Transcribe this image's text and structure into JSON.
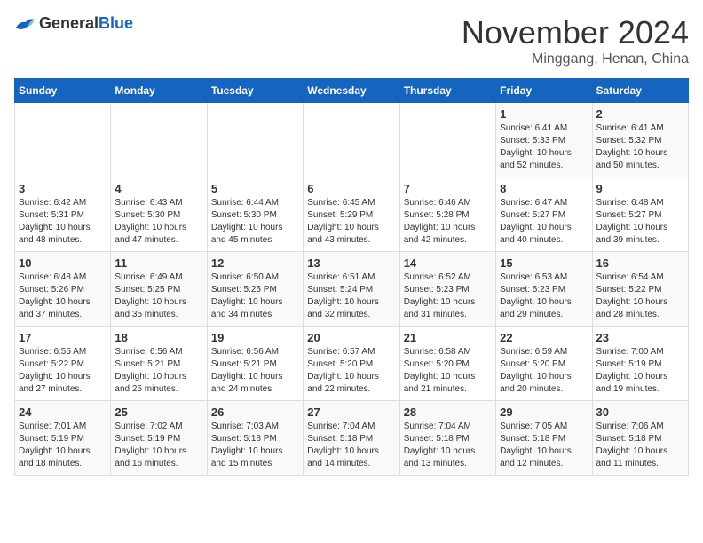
{
  "header": {
    "logo_general": "General",
    "logo_blue": "Blue",
    "month_title": "November 2024",
    "location": "Minggang, Henan, China"
  },
  "weekdays": [
    "Sunday",
    "Monday",
    "Tuesday",
    "Wednesday",
    "Thursday",
    "Friday",
    "Saturday"
  ],
  "weeks": [
    [
      {
        "day": "",
        "info": ""
      },
      {
        "day": "",
        "info": ""
      },
      {
        "day": "",
        "info": ""
      },
      {
        "day": "",
        "info": ""
      },
      {
        "day": "",
        "info": ""
      },
      {
        "day": "1",
        "info": "Sunrise: 6:41 AM\nSunset: 5:33 PM\nDaylight: 10 hours\nand 52 minutes."
      },
      {
        "day": "2",
        "info": "Sunrise: 6:41 AM\nSunset: 5:32 PM\nDaylight: 10 hours\nand 50 minutes."
      }
    ],
    [
      {
        "day": "3",
        "info": "Sunrise: 6:42 AM\nSunset: 5:31 PM\nDaylight: 10 hours\nand 48 minutes."
      },
      {
        "day": "4",
        "info": "Sunrise: 6:43 AM\nSunset: 5:30 PM\nDaylight: 10 hours\nand 47 minutes."
      },
      {
        "day": "5",
        "info": "Sunrise: 6:44 AM\nSunset: 5:30 PM\nDaylight: 10 hours\nand 45 minutes."
      },
      {
        "day": "6",
        "info": "Sunrise: 6:45 AM\nSunset: 5:29 PM\nDaylight: 10 hours\nand 43 minutes."
      },
      {
        "day": "7",
        "info": "Sunrise: 6:46 AM\nSunset: 5:28 PM\nDaylight: 10 hours\nand 42 minutes."
      },
      {
        "day": "8",
        "info": "Sunrise: 6:47 AM\nSunset: 5:27 PM\nDaylight: 10 hours\nand 40 minutes."
      },
      {
        "day": "9",
        "info": "Sunrise: 6:48 AM\nSunset: 5:27 PM\nDaylight: 10 hours\nand 39 minutes."
      }
    ],
    [
      {
        "day": "10",
        "info": "Sunrise: 6:48 AM\nSunset: 5:26 PM\nDaylight: 10 hours\nand 37 minutes."
      },
      {
        "day": "11",
        "info": "Sunrise: 6:49 AM\nSunset: 5:25 PM\nDaylight: 10 hours\nand 35 minutes."
      },
      {
        "day": "12",
        "info": "Sunrise: 6:50 AM\nSunset: 5:25 PM\nDaylight: 10 hours\nand 34 minutes."
      },
      {
        "day": "13",
        "info": "Sunrise: 6:51 AM\nSunset: 5:24 PM\nDaylight: 10 hours\nand 32 minutes."
      },
      {
        "day": "14",
        "info": "Sunrise: 6:52 AM\nSunset: 5:23 PM\nDaylight: 10 hours\nand 31 minutes."
      },
      {
        "day": "15",
        "info": "Sunrise: 6:53 AM\nSunset: 5:23 PM\nDaylight: 10 hours\nand 29 minutes."
      },
      {
        "day": "16",
        "info": "Sunrise: 6:54 AM\nSunset: 5:22 PM\nDaylight: 10 hours\nand 28 minutes."
      }
    ],
    [
      {
        "day": "17",
        "info": "Sunrise: 6:55 AM\nSunset: 5:22 PM\nDaylight: 10 hours\nand 27 minutes."
      },
      {
        "day": "18",
        "info": "Sunrise: 6:56 AM\nSunset: 5:21 PM\nDaylight: 10 hours\nand 25 minutes."
      },
      {
        "day": "19",
        "info": "Sunrise: 6:56 AM\nSunset: 5:21 PM\nDaylight: 10 hours\nand 24 minutes."
      },
      {
        "day": "20",
        "info": "Sunrise: 6:57 AM\nSunset: 5:20 PM\nDaylight: 10 hours\nand 22 minutes."
      },
      {
        "day": "21",
        "info": "Sunrise: 6:58 AM\nSunset: 5:20 PM\nDaylight: 10 hours\nand 21 minutes."
      },
      {
        "day": "22",
        "info": "Sunrise: 6:59 AM\nSunset: 5:20 PM\nDaylight: 10 hours\nand 20 minutes."
      },
      {
        "day": "23",
        "info": "Sunrise: 7:00 AM\nSunset: 5:19 PM\nDaylight: 10 hours\nand 19 minutes."
      }
    ],
    [
      {
        "day": "24",
        "info": "Sunrise: 7:01 AM\nSunset: 5:19 PM\nDaylight: 10 hours\nand 18 minutes."
      },
      {
        "day": "25",
        "info": "Sunrise: 7:02 AM\nSunset: 5:19 PM\nDaylight: 10 hours\nand 16 minutes."
      },
      {
        "day": "26",
        "info": "Sunrise: 7:03 AM\nSunset: 5:18 PM\nDaylight: 10 hours\nand 15 minutes."
      },
      {
        "day": "27",
        "info": "Sunrise: 7:04 AM\nSunset: 5:18 PM\nDaylight: 10 hours\nand 14 minutes."
      },
      {
        "day": "28",
        "info": "Sunrise: 7:04 AM\nSunset: 5:18 PM\nDaylight: 10 hours\nand 13 minutes."
      },
      {
        "day": "29",
        "info": "Sunrise: 7:05 AM\nSunset: 5:18 PM\nDaylight: 10 hours\nand 12 minutes."
      },
      {
        "day": "30",
        "info": "Sunrise: 7:06 AM\nSunset: 5:18 PM\nDaylight: 10 hours\nand 11 minutes."
      }
    ]
  ]
}
